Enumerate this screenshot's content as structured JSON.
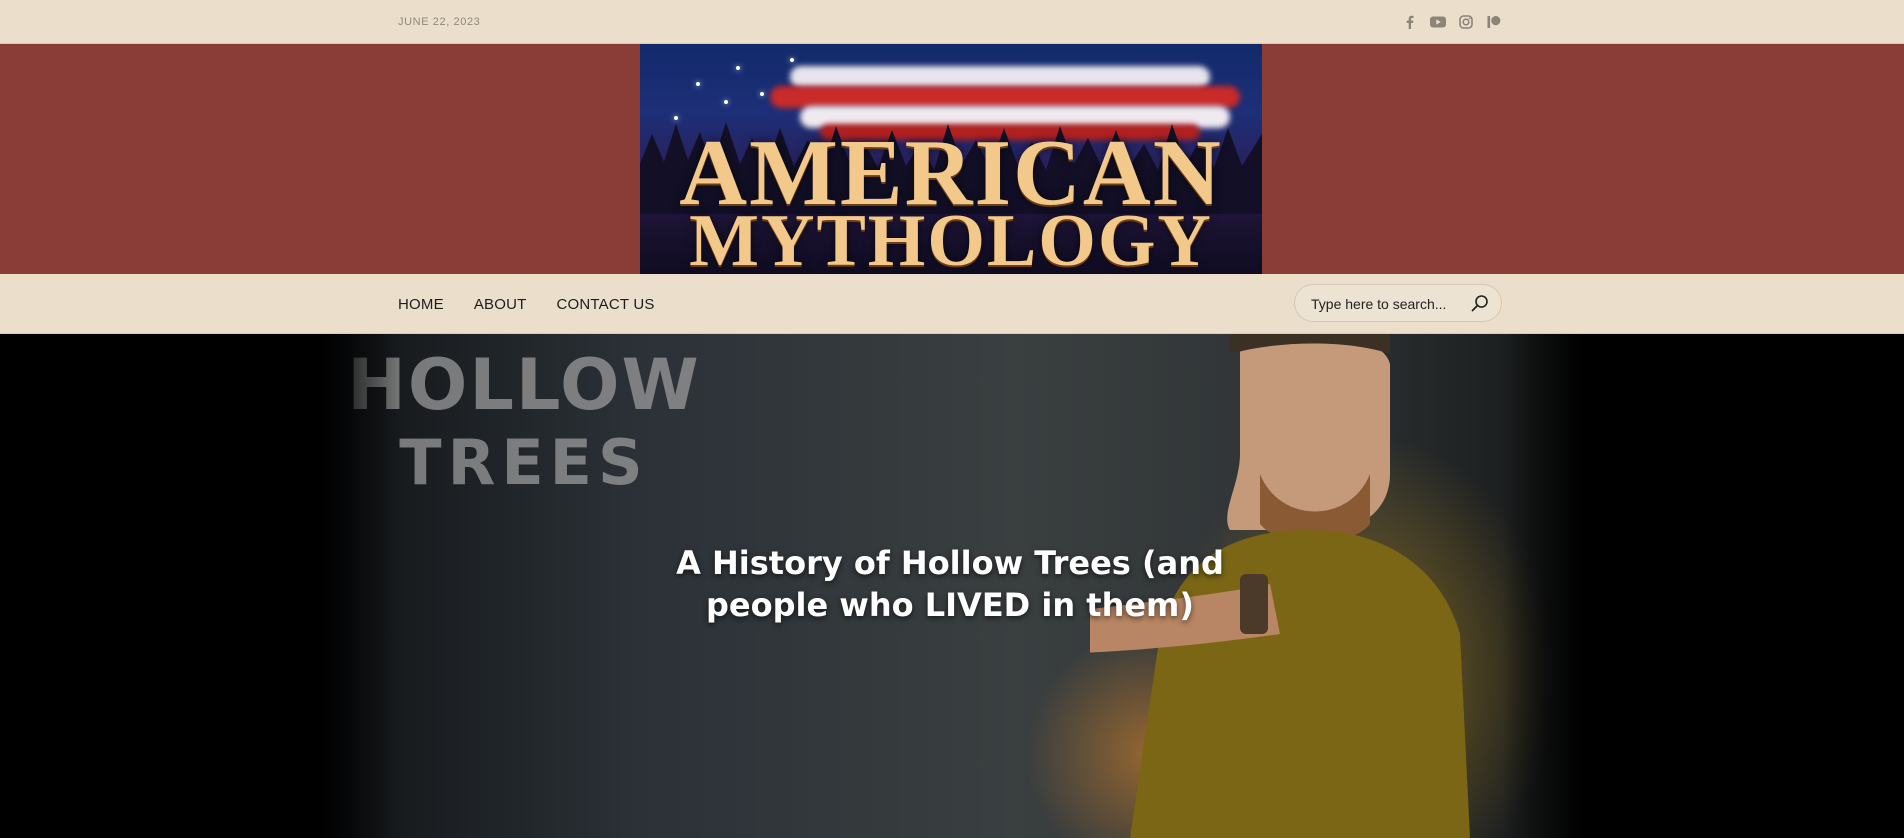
{
  "topbar": {
    "date": "JUNE 22, 2023",
    "social": [
      {
        "icon": "facebook-icon"
      },
      {
        "icon": "youtube-icon"
      },
      {
        "icon": "instagram-icon"
      },
      {
        "icon": "patreon-icon"
      }
    ]
  },
  "banner": {
    "logo_line1": "AMERICAN",
    "logo_line2": "MYTHOLOGY",
    "background_color": "#893d36"
  },
  "nav": {
    "items": [
      "HOME",
      "ABOUT",
      "CONTACT US"
    ]
  },
  "search": {
    "placeholder": "Type here to search..."
  },
  "hero": {
    "image_text_line1": "HOLLOW",
    "image_text_line2": "TREES",
    "title": "A History of Hollow Trees (and people who LIVED in them)"
  },
  "colors": {
    "topbar_bg": "#ebdfcc",
    "banner_bg": "#893d36",
    "hero_bg": "#000000"
  }
}
